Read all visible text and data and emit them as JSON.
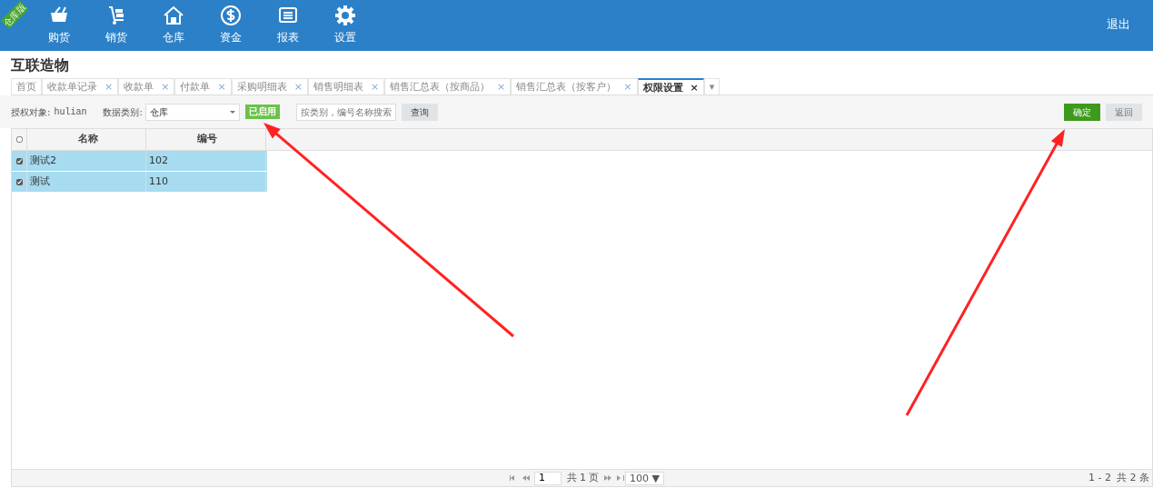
{
  "ribbon": {
    "label": "仓库版"
  },
  "nav": [
    {
      "label": "购货"
    },
    {
      "label": "销货"
    },
    {
      "label": "仓库"
    },
    {
      "label": "资金"
    },
    {
      "label": "报表"
    },
    {
      "label": "设置"
    }
  ],
  "logout": "退出",
  "company": "互联造物",
  "tabs": [
    {
      "label": "首页",
      "closable": false,
      "selected": false
    },
    {
      "label": "收款单记录",
      "closable": true,
      "selected": false
    },
    {
      "label": "收款单",
      "closable": true,
      "selected": false
    },
    {
      "label": "付款单",
      "closable": true,
      "selected": false
    },
    {
      "label": "采购明细表",
      "closable": true,
      "selected": false
    },
    {
      "label": "销售明细表",
      "closable": true,
      "selected": false
    },
    {
      "label": "销售汇总表（按商品）",
      "closable": true,
      "selected": false
    },
    {
      "label": "销售汇总表（按客户）",
      "closable": true,
      "selected": false
    },
    {
      "label": "权限设置",
      "closable": true,
      "selected": true
    }
  ],
  "tab_close": "×",
  "tab_more": "▾",
  "toolbar": {
    "target_label": "授权对象:",
    "target_value": "hulian",
    "type_label": "数据类别:",
    "type_value": "仓库",
    "status": "已启用",
    "search_placeholder": "按类别，编号名称搜索",
    "query": "查询",
    "confirm": "确定",
    "back": "返回"
  },
  "table": {
    "header_checked": false,
    "columns": [
      "名称",
      "编号"
    ],
    "rows": [
      {
        "cells": [
          "测试2",
          "102"
        ],
        "checked": true,
        "selected": true
      },
      {
        "cells": [
          "测试",
          "110"
        ],
        "checked": true,
        "selected": true
      }
    ]
  },
  "pager": {
    "page": "1",
    "pages": "共 1 页",
    "size": "100 ▼",
    "range": "1 - 2",
    "total": "共 2 条"
  },
  "annotations": [
    {
      "kind": "arrow"
    },
    {
      "kind": "arrow"
    }
  ]
}
